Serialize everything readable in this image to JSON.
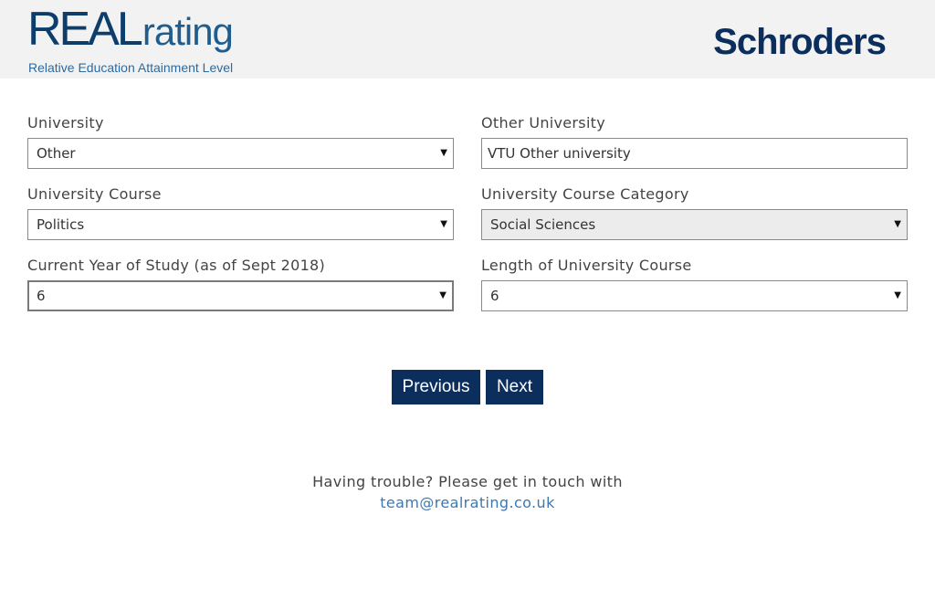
{
  "header": {
    "logo_real": "REAL",
    "logo_rating": "rating",
    "logo_subtitle": "Relative Education Attainment Level",
    "brand": "Schroders"
  },
  "form": {
    "university": {
      "label": "University",
      "value": "Other"
    },
    "other_university": {
      "label": "Other University",
      "value": "VTU Other university"
    },
    "course": {
      "label": "University Course",
      "value": "Politics"
    },
    "course_category": {
      "label": "University Course Category",
      "value": "Social Sciences"
    },
    "year": {
      "label": "Current Year of Study (as of Sept 2018)",
      "value": "6"
    },
    "length": {
      "label": "Length of University Course",
      "value": "6"
    }
  },
  "buttons": {
    "previous": "Previous",
    "next": "Next"
  },
  "help": {
    "text": "Having trouble? Please get in touch with",
    "email": "team@realrating.co.uk"
  },
  "icons": {
    "dropdown": "chevron-down-icon"
  },
  "colors": {
    "brand_navy": "#0b2e5c",
    "link": "#3d78b3",
    "header_bg": "#f2f2f2"
  }
}
